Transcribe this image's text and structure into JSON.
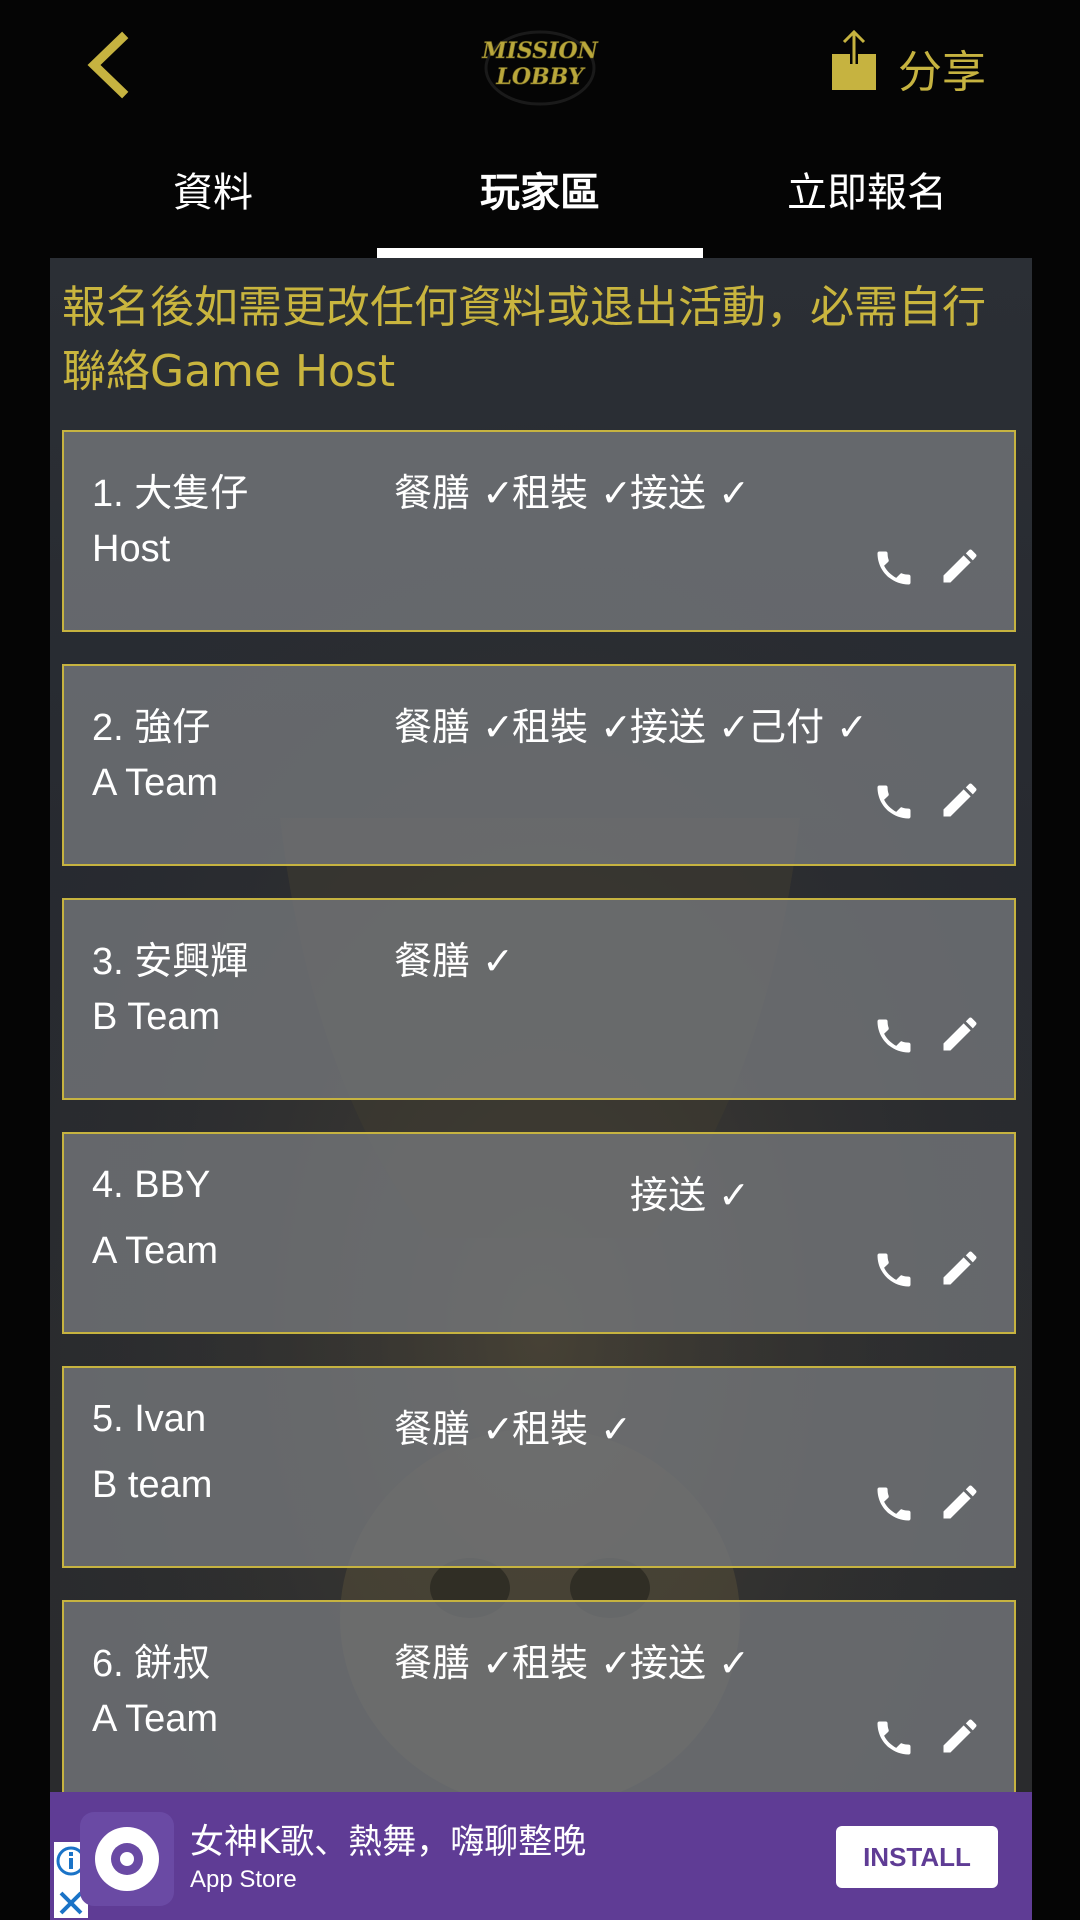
{
  "header": {
    "logo_line1": "MISSION",
    "logo_line2": "LOBBY",
    "share_label": "分享",
    "back_icon": "chevron-left-icon",
    "share_icon": "share-upload-icon"
  },
  "tabs": [
    {
      "label": "資料",
      "active": false
    },
    {
      "label": "玩家區",
      "active": true
    },
    {
      "label": "立即報名",
      "active": false
    }
  ],
  "notice": "報名後如需更改任何資料或退出活動，必需自行聯絡Game Host",
  "players": [
    {
      "name": "1. 大隻仔",
      "team": "Host",
      "meal": "餐膳 ✓",
      "rent": "租裝 ✓",
      "ride": "接送 ✓",
      "paid": ""
    },
    {
      "name": "2. 強仔",
      "team": "A Team",
      "meal": "餐膳 ✓",
      "rent": "租裝 ✓",
      "ride": "接送 ✓",
      "paid": "己付 ✓"
    },
    {
      "name": "3. 安興輝",
      "team": "B Team",
      "meal": "餐膳 ✓",
      "rent": "",
      "ride": "",
      "paid": ""
    },
    {
      "name": "4. BBY",
      "team": "A Team",
      "meal": "",
      "rent": "",
      "ride": "接送 ✓",
      "paid": ""
    },
    {
      "name": "5. Ivan",
      "team": "B team",
      "meal": "餐膳 ✓",
      "rent": "租裝 ✓",
      "ride": "",
      "paid": ""
    },
    {
      "name": "6. 餅叔",
      "team": "A Team",
      "meal": "餐膳 ✓",
      "rent": "租裝 ✓",
      "ride": "接送 ✓",
      "paid": ""
    }
  ],
  "ad": {
    "title": "女神K歌、熱舞，嗨聊整晚",
    "subtitle": "App Store",
    "install_label": "INSTALL"
  },
  "colors": {
    "accent": "#c6b340",
    "background": "#050505",
    "card": "#76787c",
    "ad_background": "#5f3c95"
  }
}
